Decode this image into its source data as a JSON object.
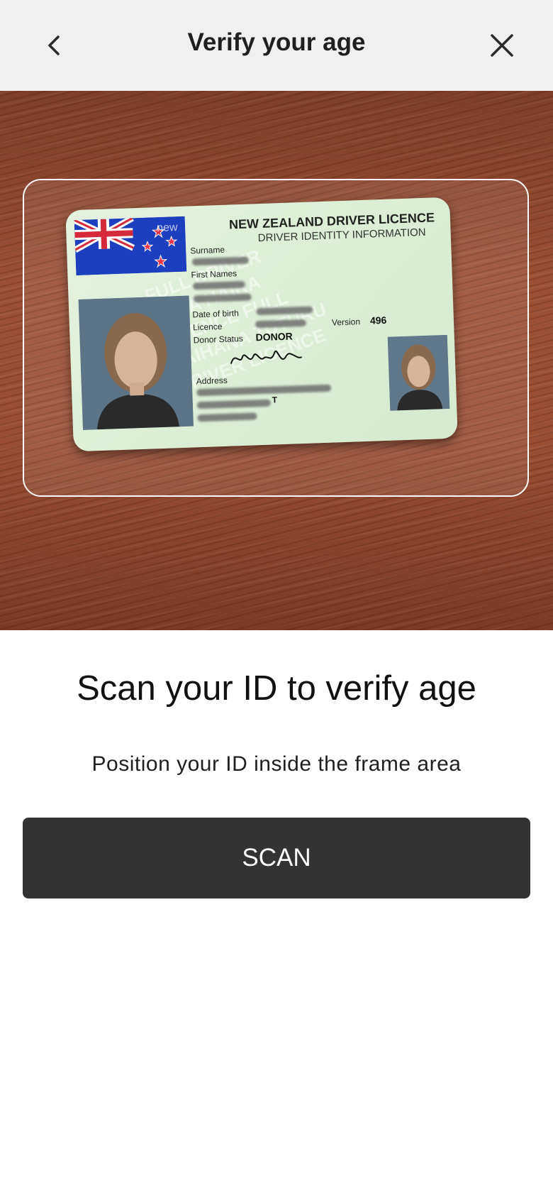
{
  "header": {
    "title": "Verify your age",
    "back_icon": "chevron-left-icon",
    "close_icon": "close-icon"
  },
  "id_card": {
    "title": "NEW ZEALAND DRIVER LICENCE",
    "subtitle": "DRIVER IDENTITY INFORMATION",
    "surname_label": "Surname",
    "first_names_label": "First Names",
    "dob_label": "Date of birth",
    "licence_label": "Licence",
    "version_label": "Version",
    "version_value": "496",
    "donor_label": "Donor Status",
    "donor_value": "DONOR",
    "address_label": "Address",
    "address_fragment": "T",
    "flag_text": "new",
    "watermark_lines": [
      "FULL DRIVER",
      "TARA HAIRA",
      "LICENCE FULL",
      "RAIHANA TUTURU",
      "DRIVER LICENCE"
    ]
  },
  "sheet": {
    "title": "Scan your ID to verify age",
    "instruction": "Position your ID inside the frame area",
    "scan_label": "SCAN"
  },
  "colors": {
    "header_bg": "#f0f0f0",
    "button_bg": "#333333",
    "button_text": "#ffffff",
    "frame_border": "#ffffff"
  }
}
